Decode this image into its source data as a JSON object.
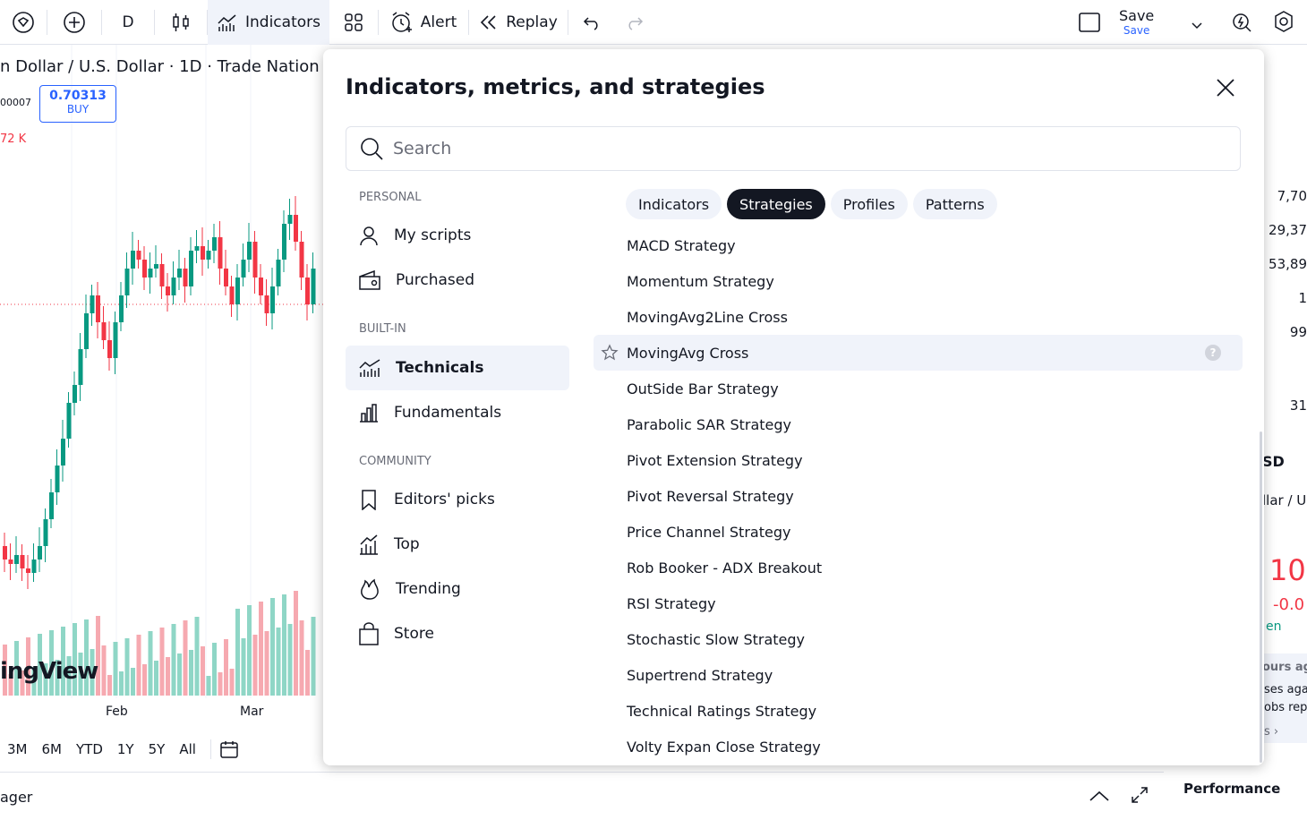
{
  "toolbar": {
    "interval": "D",
    "indicators_label": "Indicators",
    "alert_label": "Alert",
    "replay_label": "Replay",
    "save_label": "Save",
    "save_sub": "Save"
  },
  "chart": {
    "symbol_title": "n Dollar / U.S. Dollar · 1D · Trade Nation",
    "buy_price": "0.70313",
    "buy_label": "BUY",
    "left_small": "00007",
    "vol_label": "72 K",
    "logo_text": "ingView",
    "months": [
      "Feb",
      "Mar"
    ],
    "ranges": [
      "3M",
      "6M",
      "YTD",
      "1Y",
      "5Y",
      "All"
    ],
    "bottom_label": "ager"
  },
  "right_panel": {
    "numbers": [
      "7,70",
      "29,37",
      "53,89",
      "1",
      "99",
      "31"
    ],
    "symbol_fragment": "SD",
    "name_fragment": "llar / U",
    "price_fragment": "10",
    "change_fragment": "-0.0",
    "open_fragment": "en",
    "news1": "ours ag",
    "news2": "ses aga",
    "news3": "obs rep",
    "more": "s ›",
    "performance": "Performance"
  },
  "modal": {
    "title": "Indicators, metrics, and strategies",
    "search_placeholder": "Search",
    "sections": {
      "personal": "PERSONAL",
      "built_in": "BUILT-IN",
      "community": "COMMUNITY"
    },
    "nav": {
      "my_scripts": "My scripts",
      "purchased": "Purchased",
      "technicals": "Technicals",
      "fundamentals": "Fundamentals",
      "editors_picks": "Editors' picks",
      "top": "Top",
      "trending": "Trending",
      "store": "Store"
    },
    "chips": [
      "Indicators",
      "Strategies",
      "Profiles",
      "Patterns"
    ],
    "active_chip": "Strategies",
    "strategies": [
      "MACD Strategy",
      "Momentum Strategy",
      "MovingAvg2Line Cross",
      "MovingAvg Cross",
      "OutSide Bar Strategy",
      "Parabolic SAR Strategy",
      "Pivot Extension Strategy",
      "Pivot Reversal Strategy",
      "Price Channel Strategy",
      "Rob Booker - ADX Breakout",
      "RSI Strategy",
      "Stochastic Slow Strategy",
      "Supertrend Strategy",
      "Technical Ratings Strategy",
      "Volty Expan Close Strategy"
    ],
    "help_glyph": "?"
  },
  "colors": {
    "accent": "#2962ff",
    "up": "#089981",
    "down": "#f23645",
    "vol_up": "#8fd6c6",
    "vol_down": "#f6a9b0"
  }
}
